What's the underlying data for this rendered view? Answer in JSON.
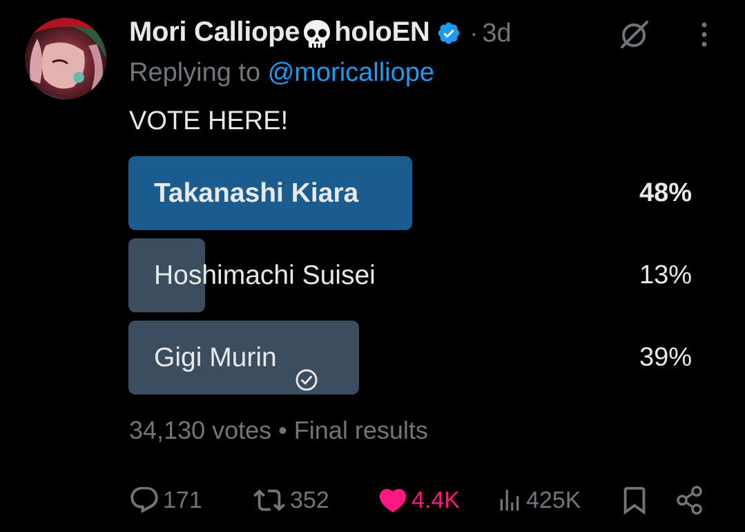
{
  "tweet": {
    "author_name_part1": "Mori Calliope",
    "author_name_part2": "holoEN",
    "skull_icon": "skull-icon",
    "verified_icon": "verified-badge-icon",
    "separator": "·",
    "time": "3d",
    "replying_prefix": "Replying to",
    "replying_handle": "@moricalliope",
    "text": "VOTE HERE!"
  },
  "poll": {
    "options": [
      {
        "label": "Takanashi Kiara",
        "percent_label": "48%",
        "percent": 48,
        "winner": true
      },
      {
        "label": "Hoshimachi Suisei",
        "percent_label": "13%",
        "percent": 13,
        "winner": false
      },
      {
        "label": "Gigi Murin",
        "percent_label": "39%",
        "percent": 39,
        "winner": false,
        "voted": true
      }
    ],
    "votes": "34,130 votes",
    "footer_separator": "•",
    "status": "Final results"
  },
  "actions": {
    "replies": "171",
    "reposts": "352",
    "likes": "4.4K",
    "views": "425K"
  },
  "colors": {
    "winner_bar": "#1a5c8e",
    "other_bar": "#3c4d5f",
    "accent": "#1d9bf0",
    "like": "#f91880",
    "muted": "#71767b",
    "text": "#e7e9ea"
  }
}
